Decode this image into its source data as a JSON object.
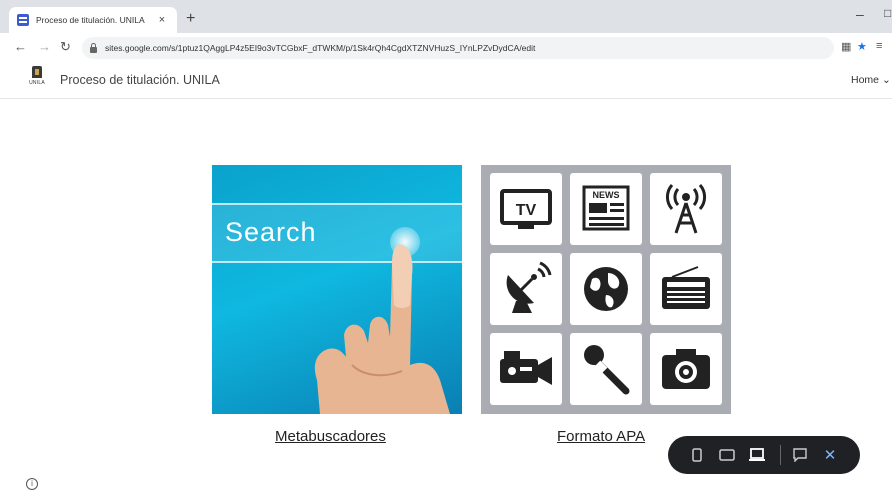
{
  "browser": {
    "tab_title": "Proceso de titulación. UNILA",
    "tab_close": "×",
    "new_tab": "+",
    "url": "sites.google.com/s/1ptuz1QAggLP4z5EI9o3vTCGbxF_dTWKM/p/1Sk4rQh4CgdXTZNVHuzS_IYnLPZvDydCA/edit",
    "minimize": "–"
  },
  "site": {
    "logo_text": "UNILA",
    "title": "Proceso de titulación. UNILA",
    "nav_home": "Home"
  },
  "cards": [
    {
      "image_text": "Search",
      "caption": "Metabuscadores"
    },
    {
      "caption": "Formato APA",
      "tv_label": "TV",
      "news_label": "NEWS"
    }
  ],
  "colors": {
    "accent_blue": "#1a73e8",
    "search_bg": "#0fb8e0",
    "media_bg": "#a9adb3",
    "preview_bar": "#202124"
  },
  "icons": {
    "media": [
      "tv-icon",
      "newspaper-icon",
      "radio-tower-icon",
      "satellite-dish-icon",
      "globe-icon",
      "radio-icon",
      "video-camera-icon",
      "microphone-icon",
      "camera-icon"
    ],
    "preview_bar": [
      "phone-preview-icon",
      "tablet-preview-icon",
      "laptop-preview-icon",
      "feedback-icon",
      "close-icon"
    ]
  }
}
